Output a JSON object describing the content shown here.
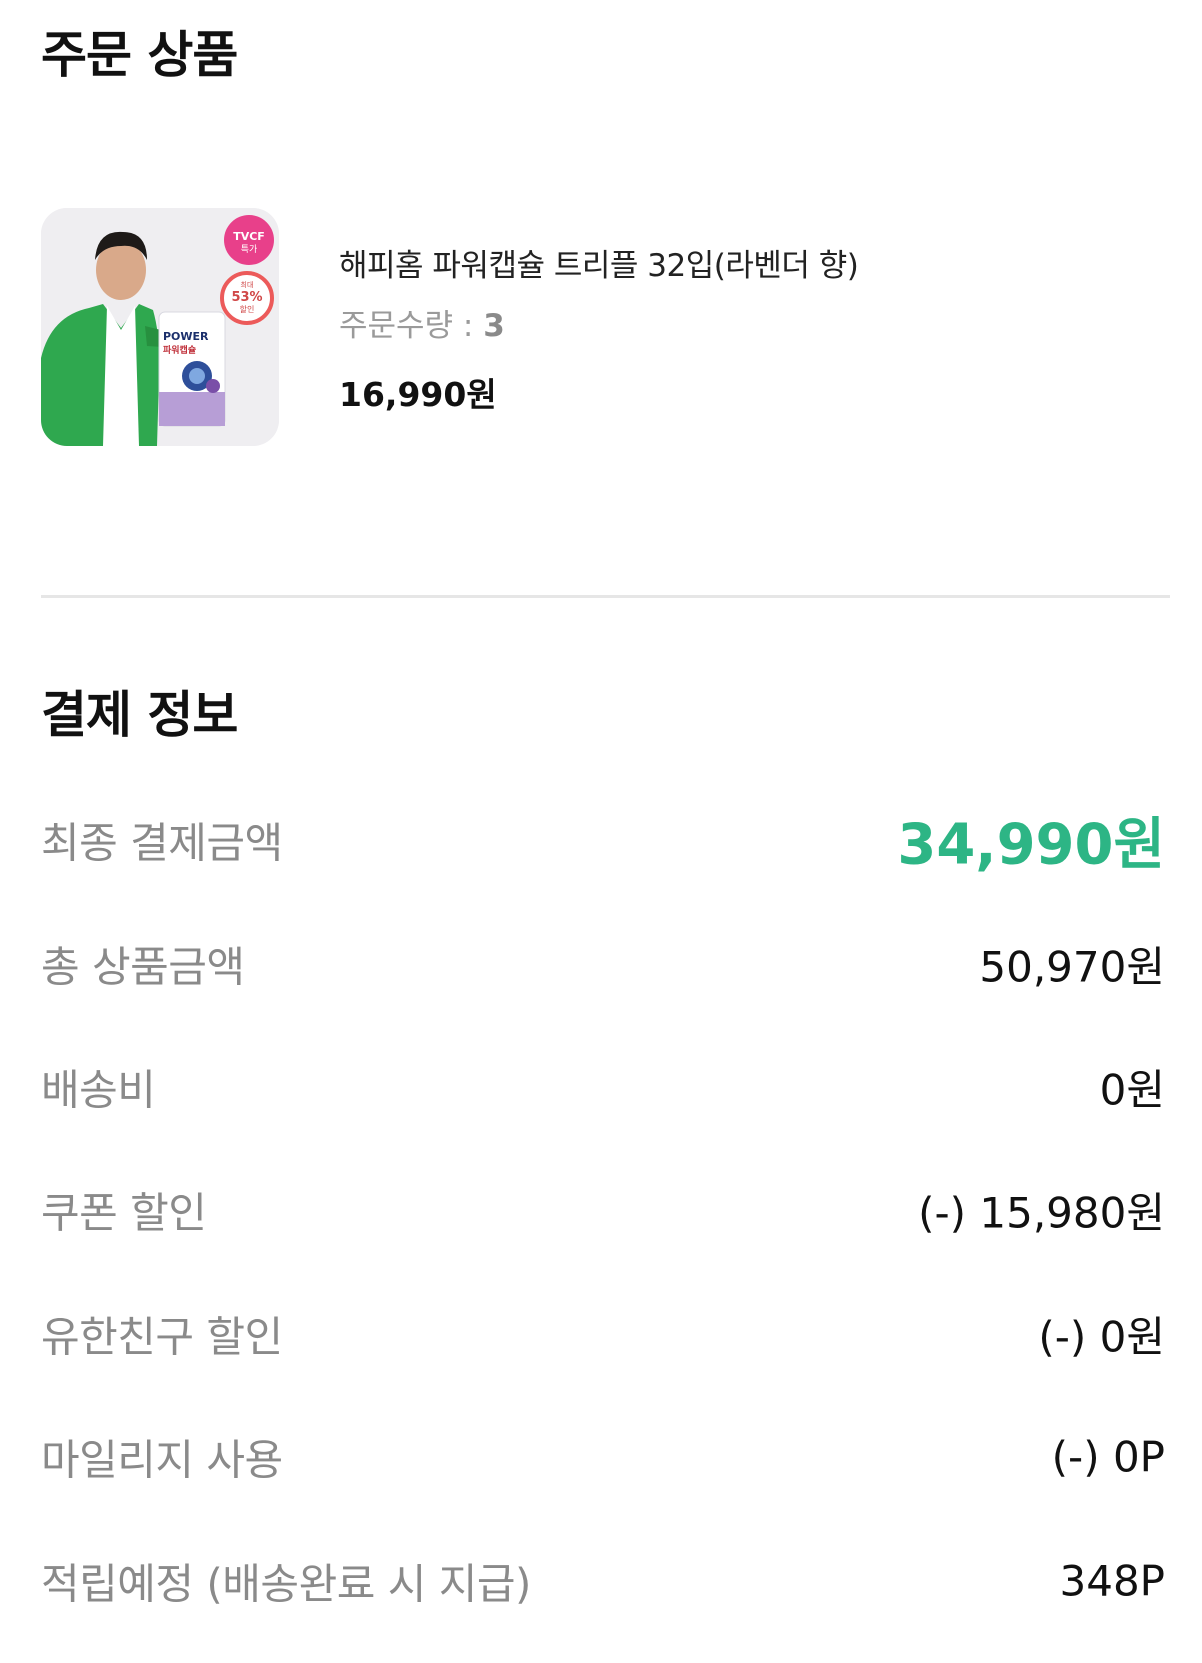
{
  "order": {
    "title": "주문 상품",
    "product": {
      "image_badge_top": "TVCF",
      "image_badge_top_sub": "특가",
      "image_badge_discount_pre": "최대",
      "image_badge_discount": "53%",
      "image_badge_discount_post": "할인",
      "image_pack_brand": "POWER",
      "image_pack_name": "파워캡슐",
      "name": "해피홈 파워캡슐 트리플 32입(라벤더 향)",
      "qty_label": "주문수량 : ",
      "qty_value": "3",
      "price": "16,990원"
    }
  },
  "payment": {
    "title": "결제 정보",
    "rows": [
      {
        "label": "최종 결제금액",
        "value": "34,990원"
      },
      {
        "label": "총 상품금액",
        "value": "50,970원"
      },
      {
        "label": "배송비",
        "value": "0원"
      },
      {
        "label": "쿠폰 할인",
        "value": "(-) 15,980원"
      },
      {
        "label": "유한친구 할인",
        "value": "(-) 0원"
      },
      {
        "label": "마일리지 사용",
        "value": "(-) 0P"
      },
      {
        "label": "적립예정 (배송완료 시 지급)",
        "value": "348P"
      }
    ]
  },
  "colors": {
    "accent_total": "#2db585",
    "label_gray": "#8a8a8a",
    "divider": "#e6e6e6",
    "jacket_green": "#2fa84f"
  }
}
